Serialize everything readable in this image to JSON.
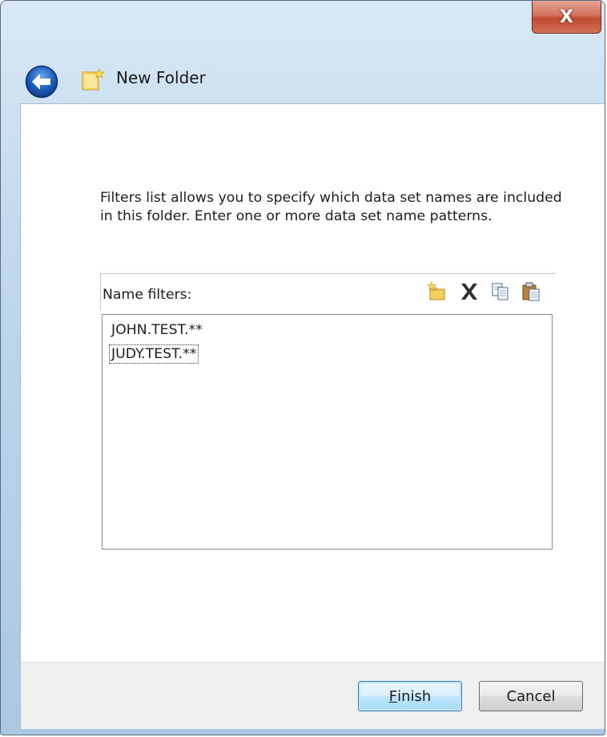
{
  "window": {
    "title": "New Folder",
    "close_label": "X"
  },
  "content": {
    "description": "Filters list allows you to specify which data set names are included in this folder.  Enter one or more data set name patterns.",
    "filters_label": "Name filters:",
    "toolbar_icons": [
      "new-filter-icon",
      "delete-icon",
      "copy-icon",
      "paste-icon"
    ],
    "filters": [
      {
        "value": "JOHN.TEST.**"
      },
      {
        "value": "JUDY.TEST.**"
      }
    ]
  },
  "footer": {
    "finish_mnemonic": "F",
    "finish_rest": "inish",
    "cancel_label": "Cancel"
  },
  "colors": {
    "frame": "#b7d1ea",
    "close_button": "#c04a30",
    "default_button_border": "#3c7fb1"
  }
}
